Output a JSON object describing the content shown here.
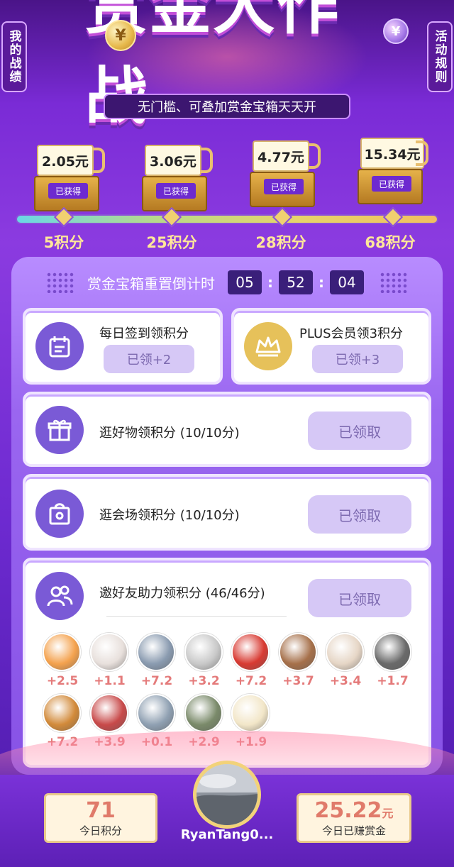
{
  "header": {
    "title": "赏金大作战",
    "subtitle": "无门槛、可叠加赏金宝箱天天开",
    "left_tab": "我的战绩",
    "right_tab": "活动规则",
    "coin_symbol": "¥"
  },
  "chests": [
    {
      "amount": "2.05元",
      "status": "已获得",
      "points": "5积分"
    },
    {
      "amount": "3.06元",
      "status": "已获得",
      "points": "25积分"
    },
    {
      "amount": "4.77元",
      "status": "已获得",
      "points": "28积分"
    },
    {
      "amount": "15.34元",
      "status": "已获得",
      "points": "68积分"
    }
  ],
  "countdown": {
    "label": "赏金宝箱重置倒计时",
    "hours": "05",
    "minutes": "52",
    "seconds": "04"
  },
  "tasks": {
    "signin": {
      "title": "每日签到领积分",
      "button": "已领+2",
      "icon": "calendar-icon"
    },
    "plus": {
      "title": "PLUS会员领3积分",
      "button": "已领+3",
      "icon": "crown-icon"
    },
    "browse_goods": {
      "title": "逛好物领积分 (10/10分)",
      "button": "已领取",
      "icon": "gift-icon"
    },
    "browse_venue": {
      "title": "逛会场领积分 (10/10分)",
      "button": "已领取",
      "icon": "shop-bag-icon"
    },
    "invite": {
      "title": "邀好友助力领积分 (46/46分)",
      "button": "已领取",
      "icon": "friends-icon"
    }
  },
  "friends": [
    {
      "value": "+2.5",
      "color": "#f4a24e"
    },
    {
      "value": "+1.1",
      "color": "#e8e0dc"
    },
    {
      "value": "+7.2",
      "color": "#8a9bb0"
    },
    {
      "value": "+3.2",
      "color": "#c9c9c9"
    },
    {
      "value": "+7.2",
      "color": "#d83a32"
    },
    {
      "value": "+3.7",
      "color": "#a6704a"
    },
    {
      "value": "+3.4",
      "color": "#e6d6c6"
    },
    {
      "value": "+1.7",
      "color": "#6a6a6a"
    },
    {
      "value": "+7.2",
      "color": "#d28a3a"
    },
    {
      "value": "+3.9",
      "color": "#c84a4a"
    },
    {
      "value": "+0.1",
      "color": "#8fa0b2"
    },
    {
      "value": "+2.9",
      "color": "#7a8a6a"
    },
    {
      "value": "+1.9",
      "color": "#f2e6c8"
    }
  ],
  "footer": {
    "points_value": "71",
    "points_caption": "今日积分",
    "bounty_value": "25.22",
    "bounty_unit": "元",
    "bounty_caption": "今日已赚赏金",
    "username": "RyanTang0..."
  },
  "colors": {
    "accent_purple": "#7a5ad6",
    "gold": "#e6c15a",
    "claimed_bg": "#d6c8f6",
    "highlight_text": "#ffe79a"
  }
}
